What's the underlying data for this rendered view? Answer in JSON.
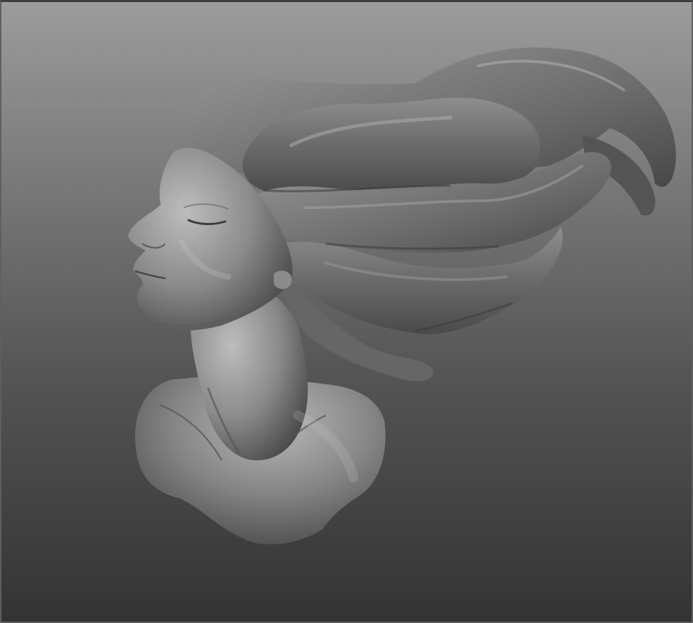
{
  "viewport": {
    "background_top": "#9c9c9c",
    "background_bottom": "#333333",
    "model_color": "#7d7d7d",
    "model_highlight": "#b5b5b5",
    "model_shadow": "#3f3f3f"
  },
  "model": {
    "parts": [
      "hair-mass",
      "face",
      "neck",
      "shoulders"
    ]
  }
}
